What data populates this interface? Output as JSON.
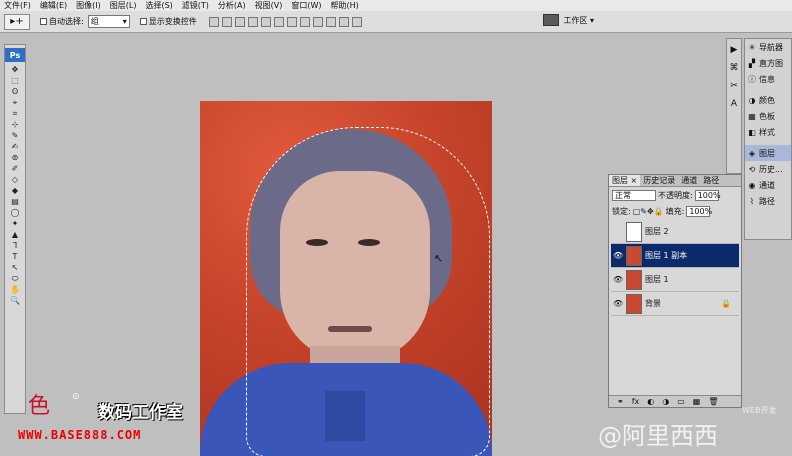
{
  "menu": [
    "文件(F)",
    "编辑(E)",
    "图像(I)",
    "图层(L)",
    "选择(S)",
    "滤镜(T)",
    "分析(A)",
    "视图(V)",
    "窗口(W)",
    "帮助(H)"
  ],
  "options": {
    "tool_icon": "move-tool",
    "auto_select_label": "自动选择:",
    "auto_select_value": "组",
    "show_transform_label": "显示变换控件",
    "workspace_label": "工作区 ▾"
  },
  "toolbox": {
    "logo": "Ps",
    "tools": [
      "✥",
      "⬚",
      "ʘ",
      "⌖",
      "⌗",
      "⊹",
      "✎",
      "✍",
      "⊚",
      "✐",
      "◇",
      "◆",
      "▤",
      "◯",
      "✦",
      "▲",
      "Ꞁ",
      "T",
      "↖",
      "⬭",
      "✋",
      "🔍"
    ]
  },
  "dock_icons": [
    "▶",
    "⌘",
    "✂",
    "A"
  ],
  "right_dock": {
    "group1": [
      "导航器",
      "直方图",
      "信息"
    ],
    "group2": [
      "颜色",
      "色板",
      "样式"
    ],
    "group3": [
      "图层",
      "历史...",
      "通道",
      "路径"
    ],
    "active": "图层"
  },
  "layers_panel": {
    "tabs": [
      "图层 ×",
      "历史记录",
      "通道",
      "路径"
    ],
    "blend_mode": "正常",
    "opacity_label": "不透明度:",
    "opacity_value": "100%",
    "lock_label": "锁定:",
    "fill_label": "填充:",
    "fill_value": "100%",
    "layers": [
      {
        "name": "图层 2",
        "visible": false,
        "selected": false,
        "thumb": "white"
      },
      {
        "name": "图层 1 副本",
        "visible": true,
        "selected": true,
        "thumb": "photo"
      },
      {
        "name": "图层 1",
        "visible": true,
        "selected": false,
        "thumb": "photo"
      },
      {
        "name": "背景",
        "visible": true,
        "selected": false,
        "thumb": "photo",
        "locked": true
      }
    ],
    "bottom_icons": [
      "⚭",
      "fx",
      "◐",
      "◑",
      "▭",
      "▦",
      "🗑"
    ]
  },
  "branding": {
    "mark": "色",
    "name": "数码工作室",
    "url": "WWW.BASE888.COM",
    "sub": "⊙"
  },
  "watermark": "@阿里西西",
  "watermark_small": "WEB开发"
}
